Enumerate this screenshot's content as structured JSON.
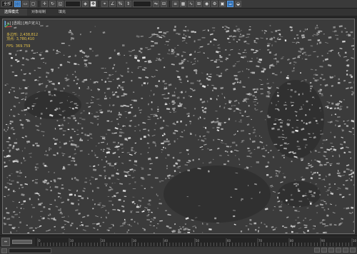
{
  "toolbar": {
    "view_combo": "全部",
    "icons": [
      "undo-icon",
      "redo-icon",
      "link-icon",
      "unlink-icon",
      "bind-icon",
      "select-icon",
      "rect-select-icon",
      "window-icon",
      "move-icon",
      "rotate-icon",
      "scale-icon",
      "view-icon",
      "snap-icon",
      "angle-snap-icon",
      "percent-snap-icon",
      "spinner-snap-icon",
      "named-set-icon",
      "mirror-icon",
      "align-icon",
      "layer-icon",
      "graphite-icon",
      "curve-editor-icon",
      "schematic-icon",
      "material-editor-icon",
      "render-setup-icon",
      "render-frame-icon",
      "render-icon",
      "teapot-icon"
    ]
  },
  "ribbon": {
    "tabs": [
      "选择模式",
      "对象绘制",
      "填充"
    ],
    "active_index": 0
  },
  "viewport": {
    "label": "[+] [透视] [用户定义]",
    "stats": {
      "polys_label": "多边形:",
      "polys_value": "2,438,812",
      "verts_label": "顶点:",
      "verts_value": "3,780,410",
      "fps_label": "FPS:",
      "fps_value": "369.759"
    },
    "colors": {
      "background": "#3b3b3b",
      "mesh": "#cfcfcf",
      "stats": "#e2c14b"
    }
  },
  "timeline": {
    "grip_label": "⇔",
    "ticks": [
      "0",
      "10",
      "20",
      "30",
      "40",
      "50",
      "60",
      "70",
      "80",
      "90",
      "100"
    ]
  }
}
